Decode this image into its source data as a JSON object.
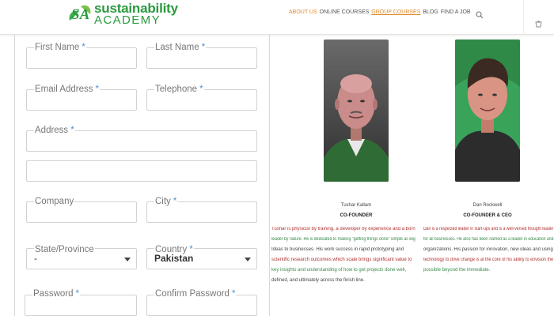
{
  "brand": {
    "name_line1": "sustainability",
    "name_line2": "ACADEMY",
    "mark_text": "SA",
    "primary_color": "#2a9a3e",
    "accent_color": "#e08a2a"
  },
  "nav": {
    "items": [
      {
        "label": "ABOUT US",
        "state": "active"
      },
      {
        "label": "ONLINE COURSES",
        "state": "normal"
      },
      {
        "label": "GROUP COURSES",
        "state": "underlined"
      },
      {
        "label": "BLOG",
        "state": "normal"
      },
      {
        "label": "FIND A JOB",
        "state": "normal"
      }
    ],
    "search_icon": "search-icon",
    "cart_icon": "cart-icon"
  },
  "form": {
    "required_mark": "*",
    "first_name": {
      "label": "First Name",
      "value": ""
    },
    "last_name": {
      "label": "Last Name",
      "value": ""
    },
    "email": {
      "label": "Email Address",
      "value": ""
    },
    "telephone": {
      "label": "Telephone",
      "value": ""
    },
    "address": {
      "label": "Address",
      "value": ""
    },
    "address2": {
      "label": "",
      "value": ""
    },
    "company": {
      "label": "Company",
      "value": ""
    },
    "city": {
      "label": "City",
      "value": ""
    },
    "state": {
      "label": "State/Province",
      "value": "-"
    },
    "country": {
      "label": "Country",
      "value": "Pakistan"
    },
    "password": {
      "label": "Password",
      "value": ""
    },
    "confirm_password": {
      "label": "Confirm Password",
      "value": ""
    }
  },
  "team": [
    {
      "name": "Tushar Kallam",
      "role": "CO-FOUNDER",
      "bio_lines": [
        "Tushar is physicist by training, a developer by experience and a born",
        "leader by nature. He is dedicated to making \"getting things done\" simple as Big",
        "Ideas to businesses. His work success in rapid prototyping and",
        "scientific research outcomes which scale brings significant value to",
        "key insights and understanding of how to get projects done well,",
        "defined, and ultimately across the finish line."
      ]
    },
    {
      "name": "Dan Rockwell",
      "role": "CO-FOUNDER & CEO",
      "bio_lines": [
        "Dan is a respected leader in start-ups and is a well-versed thought leader",
        "for all businesses. He also has been named as a leader in education and",
        "organizations. His passion for innovation, new ideas and using",
        "technology to drive change is at the core of his ability to envision the",
        "possible beyond the immediate."
      ]
    }
  ]
}
